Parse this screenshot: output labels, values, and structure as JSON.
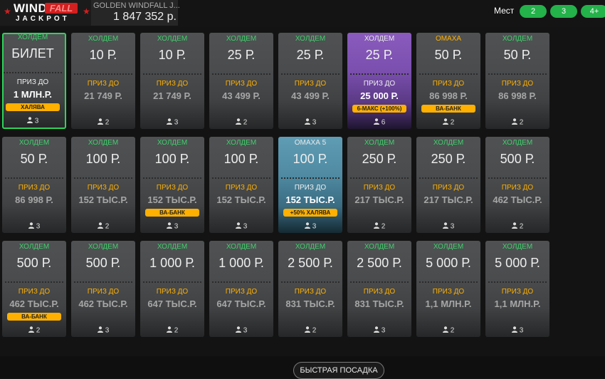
{
  "header": {
    "logo": {
      "wind": "WIND",
      "fall": "FALL",
      "jackpot": "JACKPOT"
    },
    "jackpot_name": "GOLDEN WINDFALL J...",
    "jackpot_amount": "1 847 352 р.",
    "seats_label": "Мест",
    "seat_buttons": [
      "2",
      "3",
      "4+"
    ],
    "accent_color": "#24b24b"
  },
  "prize_label": "ПРИЗ ДО",
  "cards": [
    {
      "type": "ХОЛДЕМ",
      "buyin": "БИЛЕТ",
      "prize": "1 МЛН.Р.",
      "badge": "ХАЛЯВА",
      "players": "3",
      "style": "selected"
    },
    {
      "type": "ХОЛДЕМ",
      "buyin": "10 Р.",
      "prize": "21 749 Р.",
      "badge": "",
      "players": "2",
      "style": ""
    },
    {
      "type": "ХОЛДЕМ",
      "buyin": "10 Р.",
      "prize": "21 749 Р.",
      "badge": "",
      "players": "3",
      "style": ""
    },
    {
      "type": "ХОЛДЕМ",
      "buyin": "25 Р.",
      "prize": "43 499 Р.",
      "badge": "",
      "players": "2",
      "style": ""
    },
    {
      "type": "ХОЛДЕМ",
      "buyin": "25 Р.",
      "prize": "43 499 Р.",
      "badge": "",
      "players": "3",
      "style": ""
    },
    {
      "type": "ХОЛДЕМ",
      "buyin": "25 Р.",
      "prize": "25 000 Р.",
      "badge": "6-МАКС (+100%)",
      "players": "6",
      "style": "purple"
    },
    {
      "type": "ОМАХА",
      "buyin": "50 Р.",
      "prize": "86 998 Р.",
      "badge": "ВА-БАНК",
      "players": "2",
      "style": "omaha"
    },
    {
      "type": "ХОЛДЕМ",
      "buyin": "50 Р.",
      "prize": "86 998 Р.",
      "badge": "",
      "players": "2",
      "style": ""
    },
    {
      "type": "ХОЛДЕМ",
      "buyin": "50 Р.",
      "prize": "86 998 Р.",
      "badge": "",
      "players": "3",
      "style": ""
    },
    {
      "type": "ХОЛДЕМ",
      "buyin": "100 Р.",
      "prize": "152 ТЫС.Р.",
      "badge": "",
      "players": "2",
      "style": ""
    },
    {
      "type": "ХОЛДЕМ",
      "buyin": "100 Р.",
      "prize": "152 ТЫС.Р.",
      "badge": "ВА-БАНК",
      "players": "3",
      "style": ""
    },
    {
      "type": "ХОЛДЕМ",
      "buyin": "100 Р.",
      "prize": "152 ТЫС.Р.",
      "badge": "",
      "players": "3",
      "style": ""
    },
    {
      "type": "ОМАХА 5",
      "buyin": "100 Р.",
      "prize": "152 ТЫС.Р.",
      "badge": "+50% ХАЛЯВА",
      "players": "3",
      "style": "teal"
    },
    {
      "type": "ХОЛДЕМ",
      "buyin": "250 Р.",
      "prize": "217 ТЫС.Р.",
      "badge": "",
      "players": "2",
      "style": ""
    },
    {
      "type": "ХОЛДЕМ",
      "buyin": "250 Р.",
      "prize": "217 ТЫС.Р.",
      "badge": "",
      "players": "3",
      "style": ""
    },
    {
      "type": "ХОЛДЕМ",
      "buyin": "500 Р.",
      "prize": "462 ТЫС.Р.",
      "badge": "",
      "players": "2",
      "style": ""
    },
    {
      "type": "ХОЛДЕМ",
      "buyin": "500 Р.",
      "prize": "462 ТЫС.Р.",
      "badge": "ВА-БАНК",
      "players": "2",
      "style": ""
    },
    {
      "type": "ХОЛДЕМ",
      "buyin": "500 Р.",
      "prize": "462 ТЫС.Р.",
      "badge": "",
      "players": "3",
      "style": ""
    },
    {
      "type": "ХОЛДЕМ",
      "buyin": "1 000 Р.",
      "prize": "647 ТЫС.Р.",
      "badge": "",
      "players": "2",
      "style": ""
    },
    {
      "type": "ХОЛДЕМ",
      "buyin": "1 000 Р.",
      "prize": "647 ТЫС.Р.",
      "badge": "",
      "players": "3",
      "style": ""
    },
    {
      "type": "ХОЛДЕМ",
      "buyin": "2 500 Р.",
      "prize": "831 ТЫС.Р.",
      "badge": "",
      "players": "2",
      "style": ""
    },
    {
      "type": "ХОЛДЕМ",
      "buyin": "2 500 Р.",
      "prize": "831 ТЫС.Р.",
      "badge": "",
      "players": "3",
      "style": ""
    },
    {
      "type": "ХОЛДЕМ",
      "buyin": "5 000 Р.",
      "prize": "1,1 МЛН.Р.",
      "badge": "",
      "players": "2",
      "style": ""
    },
    {
      "type": "ХОЛДЕМ",
      "buyin": "5 000 Р.",
      "prize": "1,1 МЛН.Р.",
      "badge": "",
      "players": "3",
      "style": ""
    }
  ],
  "quick_seat_label": "БЫСТРАЯ ПОСАДКА"
}
